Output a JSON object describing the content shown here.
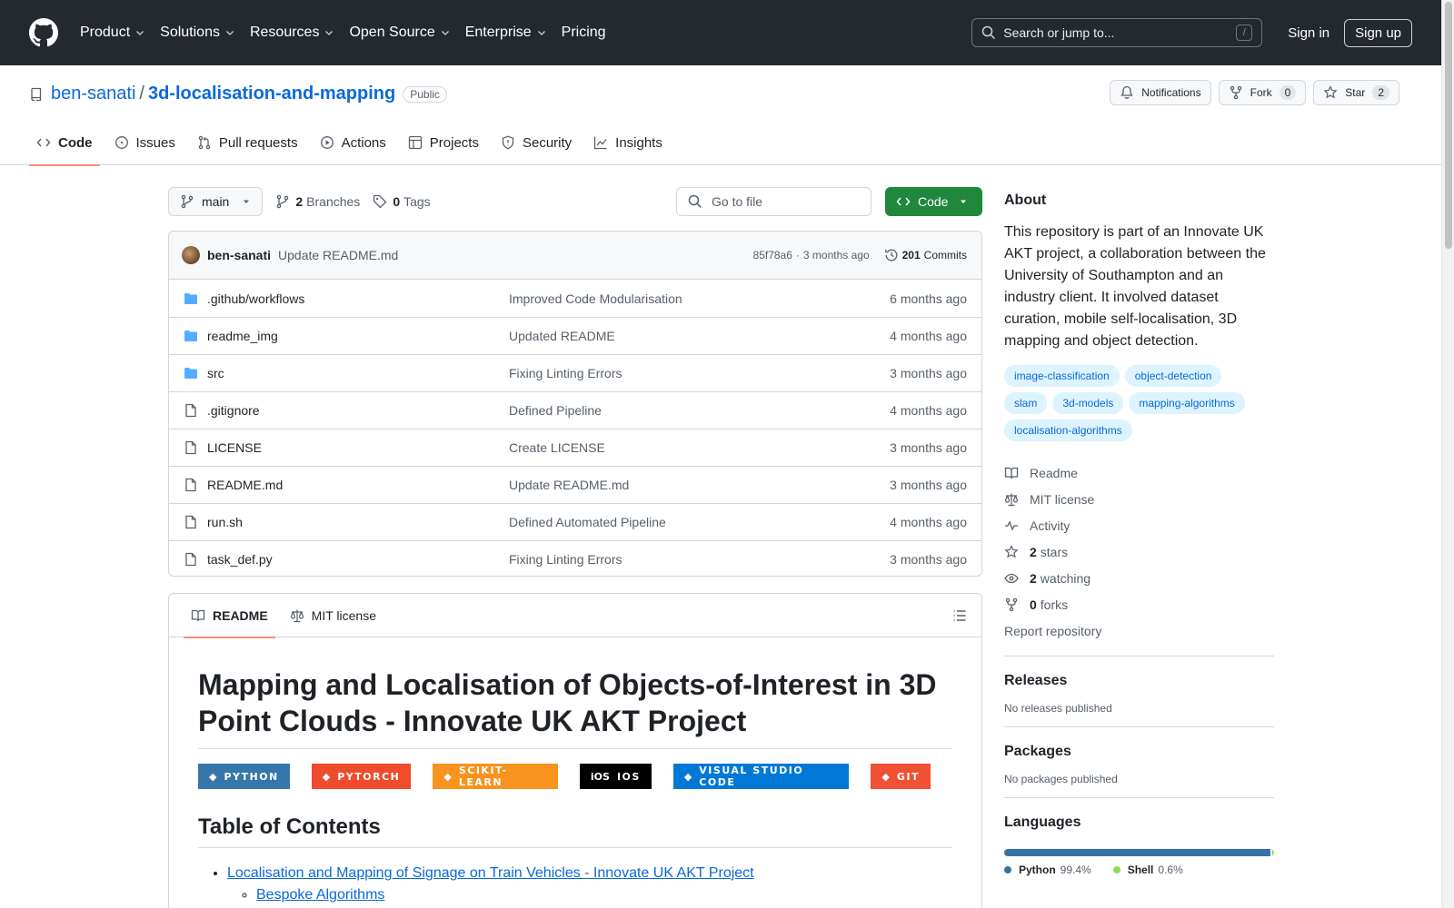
{
  "header": {
    "nav": [
      "Product",
      "Solutions",
      "Resources",
      "Open Source",
      "Enterprise",
      "Pricing"
    ],
    "search_placeholder": "Search or jump to...",
    "search_shortcut": "/",
    "sign_in": "Sign in",
    "sign_up": "Sign up"
  },
  "repo": {
    "owner": "ben-sanati",
    "separator": "/",
    "name": "3d-localisation-and-mapping",
    "visibility": "Public",
    "notifications_label": "Notifications",
    "fork_label": "Fork",
    "fork_count": "0",
    "star_label": "Star",
    "star_count": "2",
    "tabs": [
      "Code",
      "Issues",
      "Pull requests",
      "Actions",
      "Projects",
      "Security",
      "Insights"
    ]
  },
  "code": {
    "branch": "main",
    "branches_count": "2",
    "branches_label": "Branches",
    "tags_count": "0",
    "tags_label": "Tags",
    "go_to_file": "Go to file",
    "code_button": "Code",
    "latest_commit": {
      "author": "ben-sanati",
      "message": "Update README.md",
      "hash": "85f78a6",
      "dot": "·",
      "age": "3 months ago",
      "commits_count": "201",
      "commits_label": "Commits"
    },
    "files": [
      {
        "type": "dir",
        "name": ".github/workflows",
        "commit": "Improved Code Modularisation",
        "age": "6 months ago"
      },
      {
        "type": "dir",
        "name": "readme_img",
        "commit": "Updated README",
        "age": "4 months ago"
      },
      {
        "type": "dir",
        "name": "src",
        "commit": "Fixing Linting Errors",
        "age": "3 months ago"
      },
      {
        "type": "file",
        "name": ".gitignore",
        "commit": "Defined Pipeline",
        "age": "4 months ago"
      },
      {
        "type": "file",
        "name": "LICENSE",
        "commit": "Create LICENSE",
        "age": "3 months ago"
      },
      {
        "type": "file",
        "name": "README.md",
        "commit": "Update README.md",
        "age": "3 months ago"
      },
      {
        "type": "file",
        "name": "run.sh",
        "commit": "Defined Automated Pipeline",
        "age": "4 months ago"
      },
      {
        "type": "file",
        "name": "task_def.py",
        "commit": "Fixing Linting Errors",
        "age": "3 months ago"
      }
    ]
  },
  "readme": {
    "tab_readme": "README",
    "tab_license": "MIT license",
    "title": "Mapping and Localisation of Objects-of-Interest in 3D Point Clouds - Innovate UK AKT Project",
    "badges": [
      {
        "label": "PYTHON",
        "color": "#3776ab",
        "icon": "python-icon"
      },
      {
        "label": "PYTORCH",
        "color": "#ee4c2c",
        "icon": "pytorch-icon"
      },
      {
        "label": "SCIKIT-LEARN",
        "color": "#f7931e",
        "icon": "scikit-learn-icon"
      },
      {
        "label": "IOS",
        "color": "#000000",
        "icon": "ios-icon",
        "icon_text": "iOS"
      },
      {
        "label": "VISUAL STUDIO CODE",
        "color": "#0078d7",
        "icon": "vscode-icon"
      },
      {
        "label": "GIT",
        "color": "#f05033",
        "icon": "git-icon"
      }
    ],
    "toc_heading": "Table of Contents",
    "toc": [
      {
        "label": "Localisation and Mapping of Signage on Train Vehicles - Innovate UK AKT Project",
        "children": [
          "Bespoke Algorithms"
        ]
      }
    ]
  },
  "about": {
    "heading": "About",
    "description": "This repository is part of an Innovate UK AKT project, a collaboration between the University of Southampton and an industry client. It involved dataset curation, mobile self-localisation, 3D mapping and object detection.",
    "topics": [
      "image-classification",
      "object-detection",
      "slam",
      "3d-models",
      "mapping-algorithms",
      "localisation-algorithms"
    ],
    "links": {
      "readme": "Readme",
      "license": "MIT license",
      "activity": "Activity",
      "stars_count": "2",
      "stars_label": "stars",
      "watching_count": "2",
      "watching_label": "watching",
      "forks_count": "0",
      "forks_label": "forks"
    },
    "report": "Report repository"
  },
  "releases": {
    "heading": "Releases",
    "empty": "No releases published"
  },
  "packages": {
    "heading": "Packages",
    "empty": "No packages published"
  },
  "languages": {
    "heading": "Languages",
    "items": [
      {
        "name": "Python",
        "percent": "99.4%",
        "fraction": 0.994,
        "color": "#3572a5"
      },
      {
        "name": "Shell",
        "percent": "0.6%",
        "fraction": 0.006,
        "color": "#89e051"
      }
    ]
  },
  "colors": {
    "accent": "#0969da",
    "header_bg": "#24292f",
    "primary_button": "#1f883d",
    "tab_underline": "#fd8c73"
  }
}
